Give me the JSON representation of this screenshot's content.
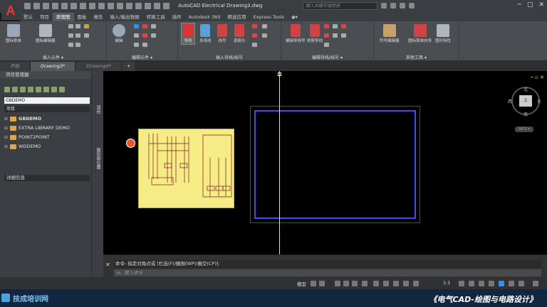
{
  "app": {
    "logo": "A",
    "title": "AutoCAD Electrical    Drawing3.dwg",
    "search_placeholder": "键入关键字或短语"
  },
  "window_controls": [
    "─",
    "□",
    "✕"
  ],
  "menu": [
    "默认",
    "项目",
    "原理图",
    "面板",
    "报告",
    "输入/输出数据",
    "转换工具",
    "插件",
    "Autodesk 360",
    "精选应用",
    "Express Tools",
    "◉▾"
  ],
  "active_menu_index": 2,
  "ribbon": {
    "panels": [
      {
        "label": "插入元件 ▾",
        "buttons": [
          "图标菜单",
          "图标编辑器"
        ]
      },
      {
        "label": "编辑元件 ▾",
        "buttons": [
          "编辑"
        ]
      },
      {
        "label": "插入导线/线号",
        "buttons": [
          "导线",
          "多母线",
          "线号",
          "源箭头"
        ]
      },
      {
        "label": "编辑导线/线号 ▾",
        "buttons": [
          "编辑导线号",
          "修剪导线"
        ]
      },
      {
        "label": "其他工具 ▾",
        "buttons": [
          "符号编辑器",
          "图标菜单向导",
          "图形特性"
        ]
      }
    ]
  },
  "doc_tabs": [
    "开始",
    "Drawing3*",
    "Drawing4*",
    "+"
  ],
  "active_doc_tab": 1,
  "project_manager": {
    "title": "项目管理器",
    "current_project": "GBDEMO",
    "section_label": "项目",
    "projects": [
      "GBDEMO",
      "EXTRA LIBRARY DEMO",
      "POINT2POINT",
      "WDDEMO"
    ],
    "details_label": "详细信息",
    "side_tabs": [
      "项目",
      "图形和位置"
    ]
  },
  "viewcube": {
    "north": "北",
    "south": "南",
    "east": "东",
    "west": "西",
    "top": "上",
    "wcs": "WCS ▾"
  },
  "command": {
    "history": "命令: 指定对角点或 [栏选(F)/圈围(WP)/圈交(CP)]:",
    "input_placeholder": "键入命令",
    "prefix": "≫-"
  },
  "status": {
    "model": "模型",
    "scale": "1:1"
  },
  "footer": {
    "logo": "技成培训网",
    "right": "《电气CAD-绘图与电路设计》"
  }
}
